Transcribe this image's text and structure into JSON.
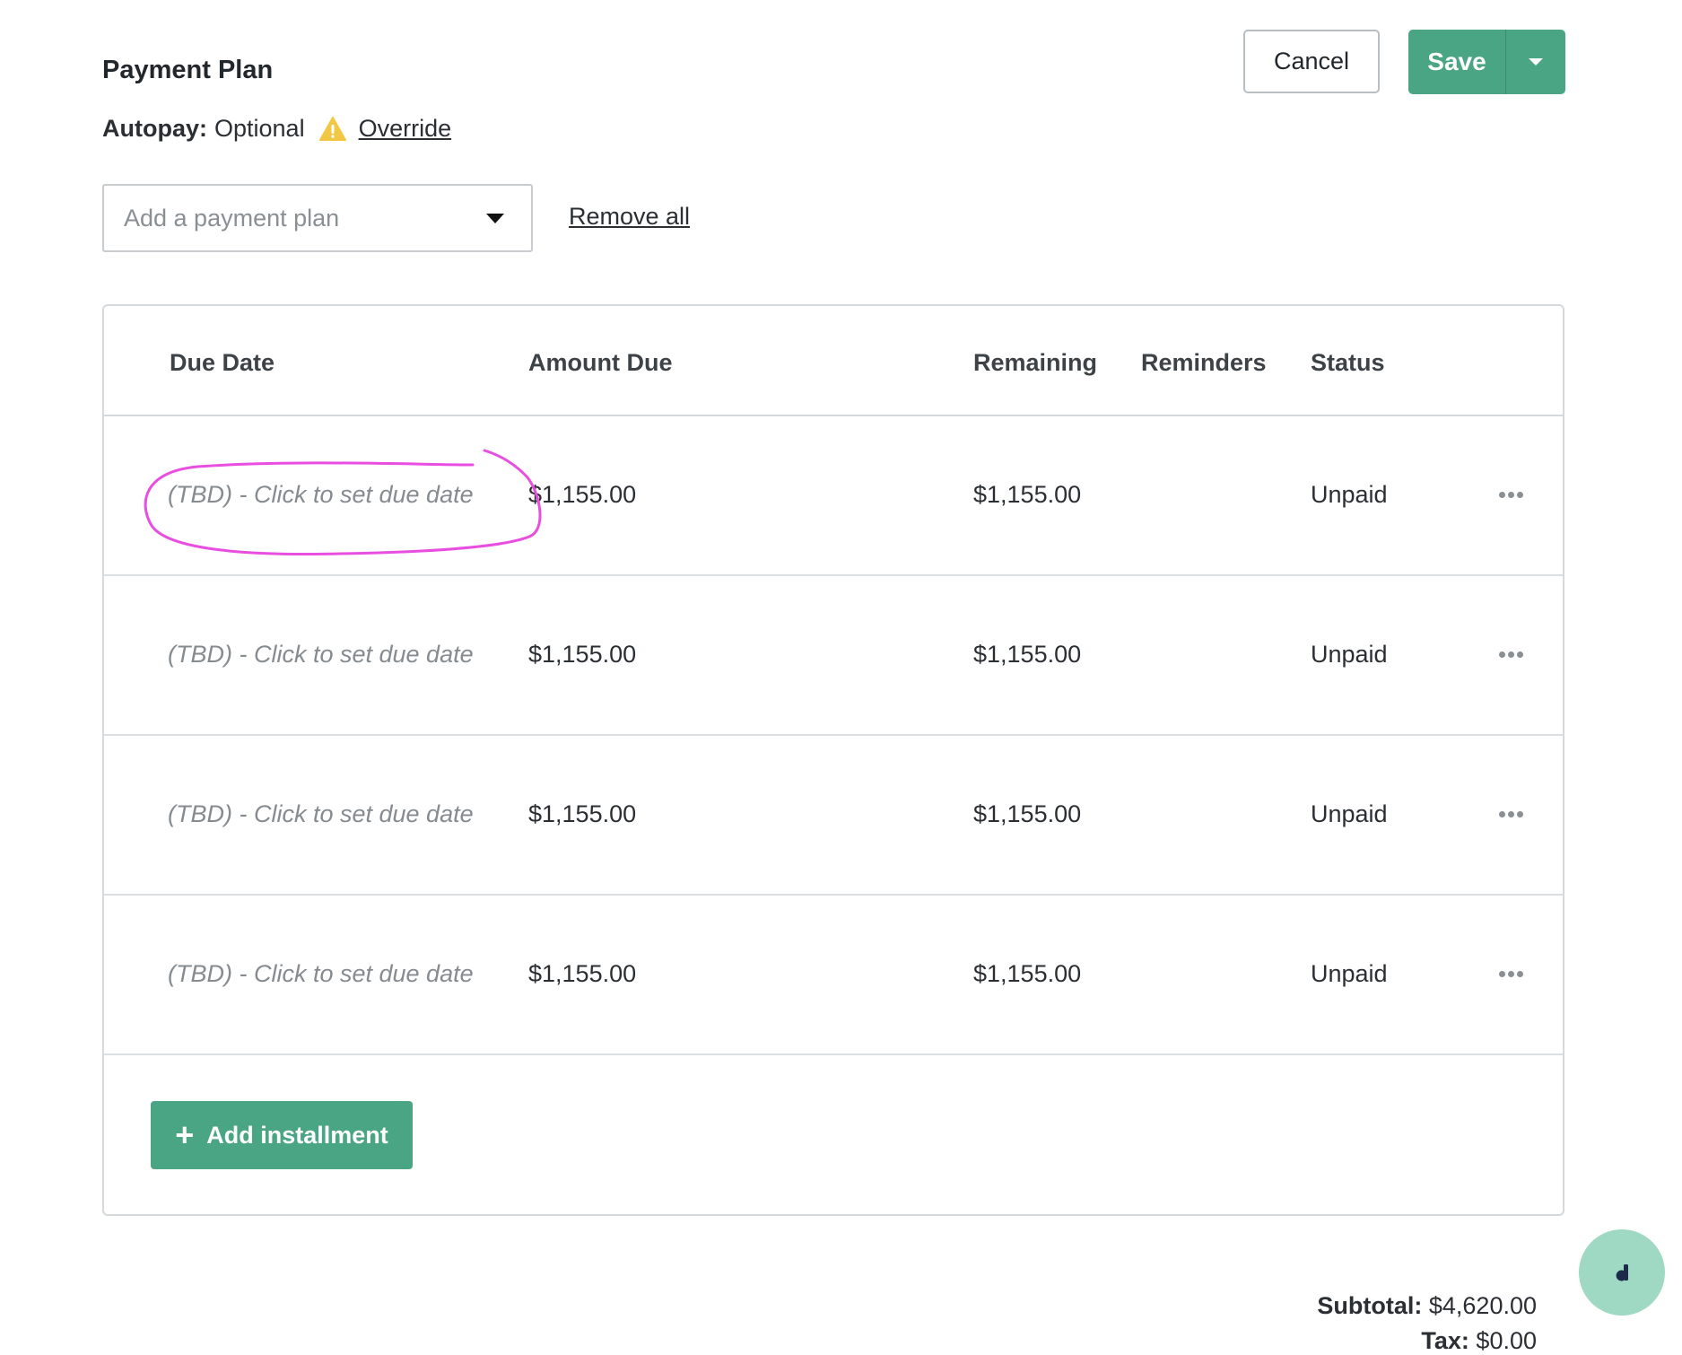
{
  "header": {
    "title": "Payment Plan",
    "autopay_label": "Autopay:",
    "autopay_value": "Optional",
    "override_link": "Override",
    "cancel_label": "Cancel",
    "save_label": "Save"
  },
  "plan_select": {
    "placeholder": "Add a payment plan"
  },
  "remove_all_label": "Remove all",
  "table": {
    "columns": [
      "Due Date",
      "Amount Due",
      "Remaining",
      "Reminders",
      "Status"
    ],
    "rows": [
      {
        "due_date": "(TBD) - Click to set due date",
        "amount_due": "$1,155.00",
        "remaining": "$1,155.00",
        "reminders": "",
        "status": "Unpaid"
      },
      {
        "due_date": "(TBD) - Click to set due date",
        "amount_due": "$1,155.00",
        "remaining": "$1,155.00",
        "reminders": "",
        "status": "Unpaid"
      },
      {
        "due_date": "(TBD) - Click to set due date",
        "amount_due": "$1,155.00",
        "remaining": "$1,155.00",
        "reminders": "",
        "status": "Unpaid"
      },
      {
        "due_date": "(TBD) - Click to set due date",
        "amount_due": "$1,155.00",
        "remaining": "$1,155.00",
        "reminders": "",
        "status": "Unpaid"
      }
    ],
    "add_installment_label": "Add installment"
  },
  "totals": {
    "subtotal_label": "Subtotal:",
    "subtotal_value": "$4,620.00",
    "tax_label": "Tax:",
    "tax_value": "$0.00"
  },
  "colors": {
    "primary_green": "#4aa585",
    "warning_yellow": "#f2c744",
    "annotation_magenta": "#e84ee0",
    "fab_mint": "#9fd9c3"
  },
  "icons": {
    "warning": "warning-triangle-icon",
    "caret": "caret-down-icon",
    "more": "more-horizontal-icon",
    "plus": "plus-icon",
    "help": "help-chat-icon"
  }
}
